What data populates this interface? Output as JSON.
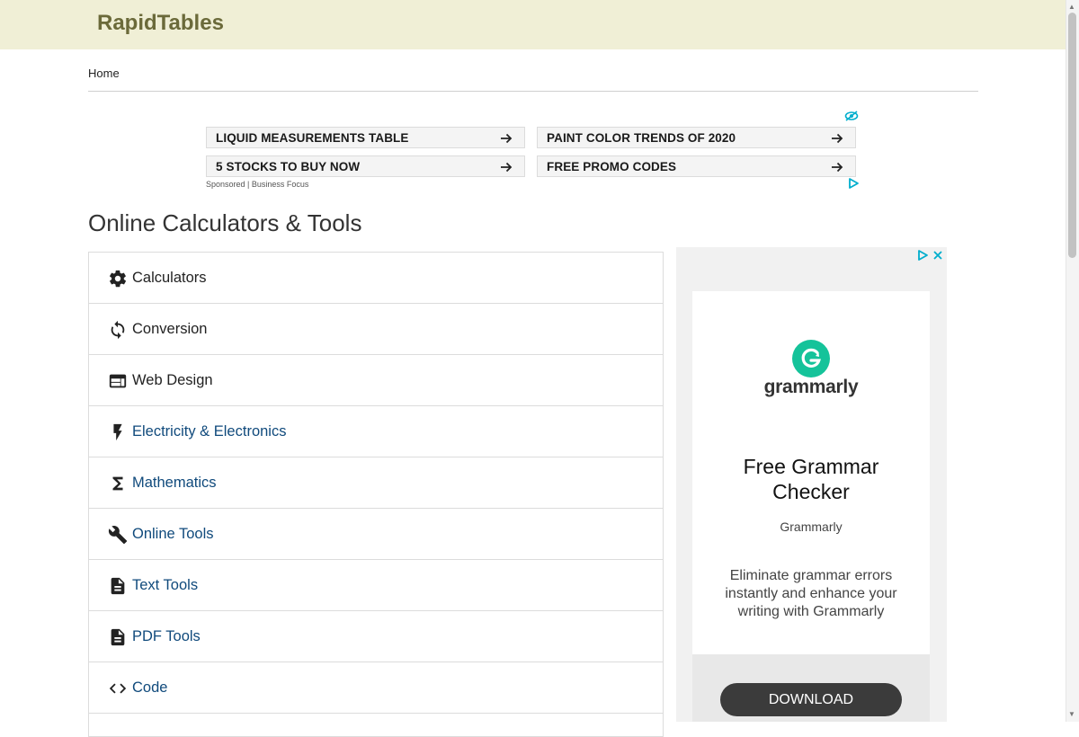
{
  "header": {
    "logo": "RapidTables"
  },
  "breadcrumb": {
    "home": "Home"
  },
  "sponsored_ads": {
    "links": [
      "LIQUID MEASUREMENTS TABLE",
      "PAINT COLOR TRENDS OF 2020",
      "5 STOCKS TO BUY NOW",
      "FREE PROMO CODES"
    ],
    "footer": "Sponsored | Business Focus"
  },
  "main": {
    "title": "Online Calculators & Tools",
    "categories": [
      {
        "label": "Calculators",
        "icon": "gear-icon"
      },
      {
        "label": "Conversion",
        "icon": "refresh-icon"
      },
      {
        "label": "Web Design",
        "icon": "web-window-icon"
      },
      {
        "label": "Electricity & Electronics",
        "icon": "lightning-icon"
      },
      {
        "label": "Mathematics",
        "icon": "sigma-icon"
      },
      {
        "label": "Online Tools",
        "icon": "wrench-icon"
      },
      {
        "label": "Text Tools",
        "icon": "document-icon"
      },
      {
        "label": "PDF Tools",
        "icon": "document-icon"
      },
      {
        "label": "Code",
        "icon": "code-icon"
      }
    ]
  },
  "side_ad": {
    "brand_logo_text": "grammarly",
    "headline": "Free Grammar Checker",
    "advertiser": "Grammarly",
    "description": "Eliminate grammar errors instantly and enhance your writing with Grammarly",
    "button": "DOWNLOAD"
  },
  "colors": {
    "topbar_bg": "#f0efd6",
    "logo": "#6b6a3a",
    "link": "#104a7c",
    "grammarly_green": "#15c39a",
    "adchoices_blue": "#00aecd"
  }
}
